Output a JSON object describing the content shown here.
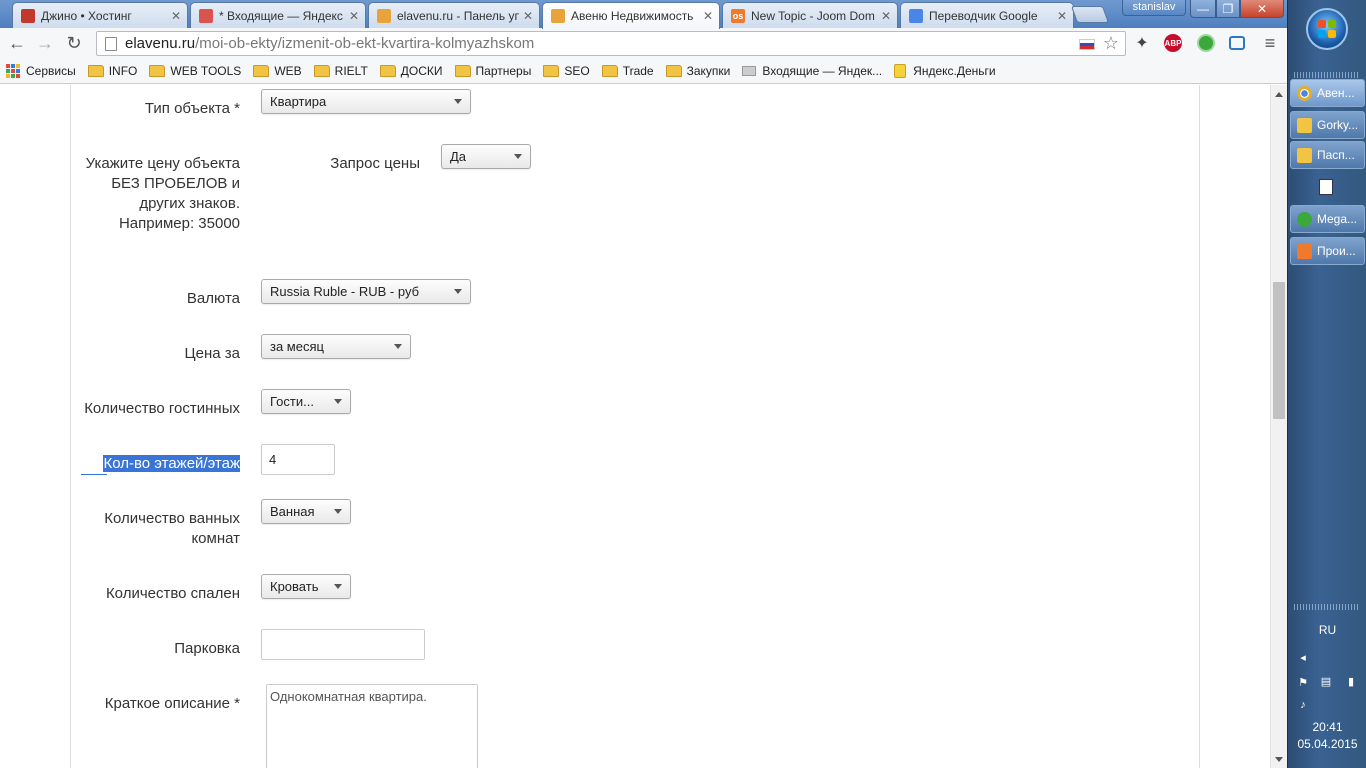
{
  "browser": {
    "tabs": [
      {
        "title": "Джино • Хостинг",
        "favicon_color": "#c0392b"
      },
      {
        "title": "* Входящие — Яндекс",
        "favicon_color": "#d9534f"
      },
      {
        "title": "elavenu.ru - Панель уп",
        "favicon_color": "#e8a33c"
      },
      {
        "title": "Авеню Недвижимость",
        "favicon_color": "#e8a33c"
      },
      {
        "title": "New Topic - Joom Dom",
        "favicon_color": "#f07a2b",
        "favicon_text": "os"
      },
      {
        "title": "Переводчик Google",
        "favicon_color": "#4a86e8"
      }
    ],
    "active_tab_index": 3,
    "user_name": "stanislav",
    "window_controls": {
      "min": "—",
      "max": "❐",
      "close": "✕"
    },
    "url": {
      "host": "elavenu.ru",
      "path": "/moi-ob-ekty/izmenit-ob-ekt-kvartira-kolmyazhskom"
    },
    "extensions": [
      {
        "name": "puzzle-extension-icon",
        "color": "#444",
        "text": ""
      },
      {
        "name": "adblock-plus-icon",
        "color": "#c70d2c",
        "text": "ABP"
      },
      {
        "name": "green-circle-extension-icon",
        "color": "#3aa83a",
        "text": ""
      },
      {
        "name": "folder-sync-extension-icon",
        "color": "#2b79c2",
        "text": ""
      }
    ],
    "bookmarks": [
      {
        "label": "Сервисы",
        "type": "apps"
      },
      {
        "label": "INFO",
        "type": "folder"
      },
      {
        "label": "WEB TOOLS",
        "type": "folder"
      },
      {
        "label": "WEB",
        "type": "folder"
      },
      {
        "label": "RIELT",
        "type": "folder"
      },
      {
        "label": "ДОСКИ",
        "type": "folder"
      },
      {
        "label": "Партнеры",
        "type": "folder"
      },
      {
        "label": "SEO",
        "type": "folder"
      },
      {
        "label": "Trade",
        "type": "folder"
      },
      {
        "label": "Закупки",
        "type": "folder"
      },
      {
        "label": "Входящие — Яндек...",
        "type": "mail"
      },
      {
        "label": "Яндекс.Деньги",
        "type": "money"
      }
    ]
  },
  "form": {
    "object_type": {
      "label": "Тип объекта *",
      "value": "Квартира"
    },
    "price_hint": {
      "lines": [
        "Укажите цену объекта",
        "БЕЗ ПРОБЕЛОВ и",
        "других знаков.",
        "Например: 35000"
      ]
    },
    "price_request": {
      "label": "Запрос цены",
      "value": "Да"
    },
    "currency": {
      "label": "Валюта",
      "value": "Russia Ruble - RUB - руб"
    },
    "price_per": {
      "label": "Цена за",
      "value": "за месяц"
    },
    "living_rooms": {
      "label": "Количество гостинных",
      "value": "Гости..."
    },
    "floors": {
      "label": "Кол-во этажей/этаж",
      "value": "4"
    },
    "bathrooms": {
      "label_lines": [
        "Количество ванных",
        "комнат"
      ],
      "value": "Ванная"
    },
    "bedrooms": {
      "label": "Количество спален",
      "value": "Кровать"
    },
    "parking": {
      "label": "Парковка",
      "value": ""
    },
    "short_description": {
      "label": "Краткое описание *",
      "value": "Однокомнатная квартира."
    }
  },
  "taskbar": {
    "buttons": [
      {
        "label": "Авен...",
        "icon_color": "#e0b02b",
        "active": true
      },
      {
        "label": "Gorky...",
        "icon_color": "#f2c443",
        "active": false
      },
      {
        "label": "Пасп...",
        "icon_color": "#f2c443",
        "active": false
      },
      {
        "label": "Mega...",
        "icon_color": "#3aa83a",
        "active": false
      },
      {
        "label": "Прои...",
        "icon_color": "#f07a2b",
        "active": false
      }
    ],
    "language": "RU",
    "time": "20:41",
    "date": "05.04.2015"
  }
}
